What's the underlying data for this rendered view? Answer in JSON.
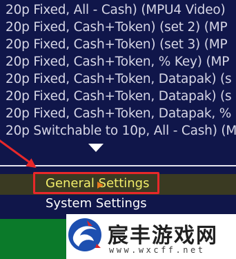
{
  "game_list": {
    "items": [
      "20p Fixed, All - Cash) (MPU4 Video)",
      "20p Fixed, Cash+Token) (set 2) (MP",
      "20p Fixed, Cash+Token) (set 3) (MP",
      "20p Fixed, Cash+Token, % Key) (MP",
      "20p Fixed, Cash+Token, Datapak) (s",
      "20p Fixed, Cash+Token, Datapak) (s",
      "20p Fixed, Cash+Token, Datapak, %",
      "20p Switchable to 10p, All - Cash) (M"
    ],
    "scroll_indicator_icon": "triangle-down-icon"
  },
  "menu": {
    "items": [
      {
        "label": "General Settings",
        "selected": true
      },
      {
        "label": "System Settings",
        "selected": false
      }
    ],
    "cursor_icon": "triangle-right-icon"
  },
  "annotation": {
    "color": "#e8282a"
  },
  "watermark": {
    "title": "宸丰游戏网",
    "url": "www.wxcff.net"
  },
  "colors": {
    "background": "#10164a",
    "list_text": "#d6d6e6",
    "selected_text": "#f2ee6a",
    "selected_row": "#3a3a22",
    "cursor": "#e8781c",
    "green_panel": "#0b7a2a"
  }
}
